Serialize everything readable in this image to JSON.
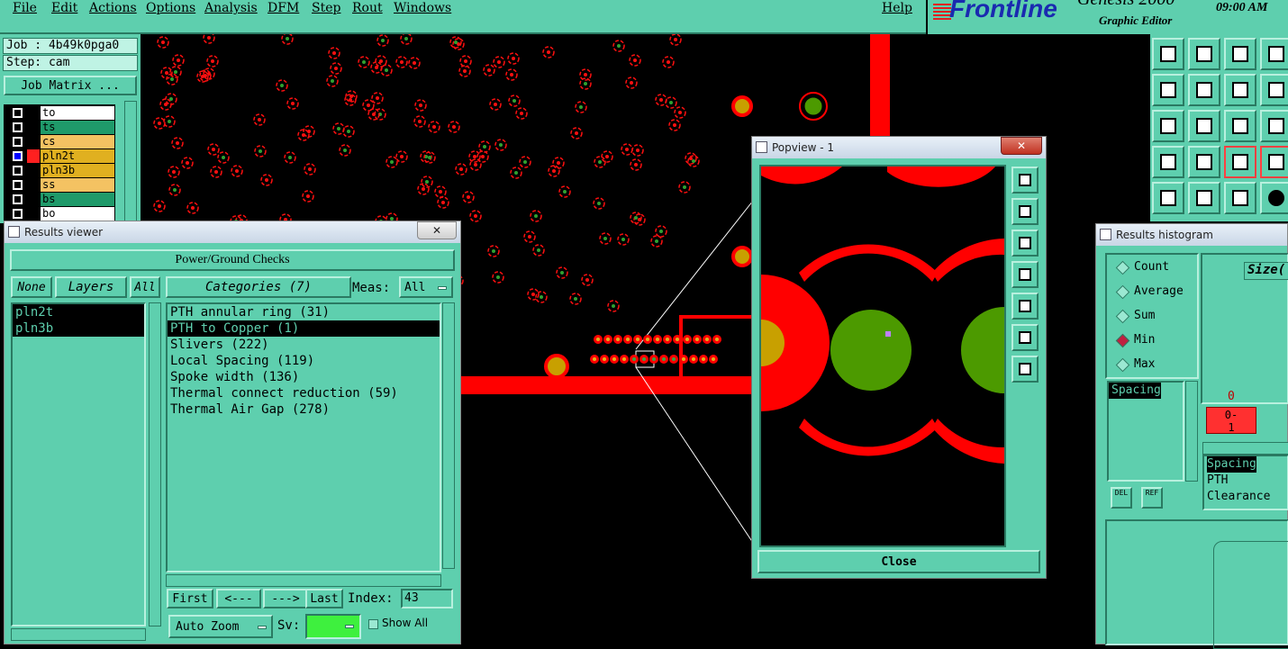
{
  "menubar": {
    "items": [
      "File",
      "Edit",
      "Actions",
      "Options",
      "Analysis",
      "DFM",
      "Step",
      "Rout",
      "Windows"
    ],
    "help": "Help"
  },
  "logo": {
    "brand": "Frontline",
    "product": "Genesis 2000",
    "subtitle": "Graphic Editor",
    "time": "09:00 AM"
  },
  "job": {
    "job_label": "Job : 4b49k0pga0",
    "step_label": "Step: cam",
    "matrix_button": "Job Matrix ..."
  },
  "layers": [
    {
      "name": "to",
      "color": "#ffffff"
    },
    {
      "name": "ts",
      "color": "#1f9a6a"
    },
    {
      "name": "cs",
      "color": "#f4c262"
    },
    {
      "name": "pln2t",
      "color": "#e0b020"
    },
    {
      "name": "pln3b",
      "color": "#e0b020"
    },
    {
      "name": "ss",
      "color": "#f4c262"
    },
    {
      "name": "bs",
      "color": "#1f9a6a"
    },
    {
      "name": "bo",
      "color": "#ffffff"
    }
  ],
  "results_viewer": {
    "title": "Results viewer",
    "close": "✕",
    "header": "Power/Ground Checks",
    "none_btn": "None",
    "layers_btn": "Layers",
    "all_btn": "All",
    "categories_btn": "Categories (7)",
    "meas_label": "Meas:",
    "meas_value": "All",
    "selected_layers": [
      "pln2t",
      "pln3b"
    ],
    "categories": [
      "PTH annular ring (31)",
      "PTH to Copper (1)",
      "Slivers (222)",
      "Local Spacing (119)",
      "Spoke width (136)",
      "Thermal connect reduction (59)",
      "Thermal Air Gap (278)"
    ],
    "selected_category_index": 1,
    "nav": {
      "first": "First",
      "prev": "<---",
      "next": "--->",
      "last": "Last",
      "index_label": "Index:",
      "index_value": "43"
    },
    "auto_zoom": "Auto Zoom",
    "sv_label": "Sv:",
    "show_all": "Show All"
  },
  "popview": {
    "title": "Popview - 1",
    "close_x": "✕",
    "close_button": "Close"
  },
  "histogram": {
    "title": "Results histogram",
    "options": [
      "Count",
      "Average",
      "Sum",
      "Min",
      "Max"
    ],
    "selected_option": "Min",
    "size_label": "Size(",
    "list_item": "Spacing",
    "del": "DEL",
    "ref": "REF",
    "bin_top": "0",
    "bin_label_a": "0-",
    "bin_label_b": "1",
    "detail": [
      "Spacing",
      "PTH",
      "Clearance"
    ]
  },
  "colors": {
    "panel": "#5ecfae",
    "copper": "#ff0000",
    "pad_gold": "#c8a000",
    "pad_green": "#4c9a00"
  }
}
